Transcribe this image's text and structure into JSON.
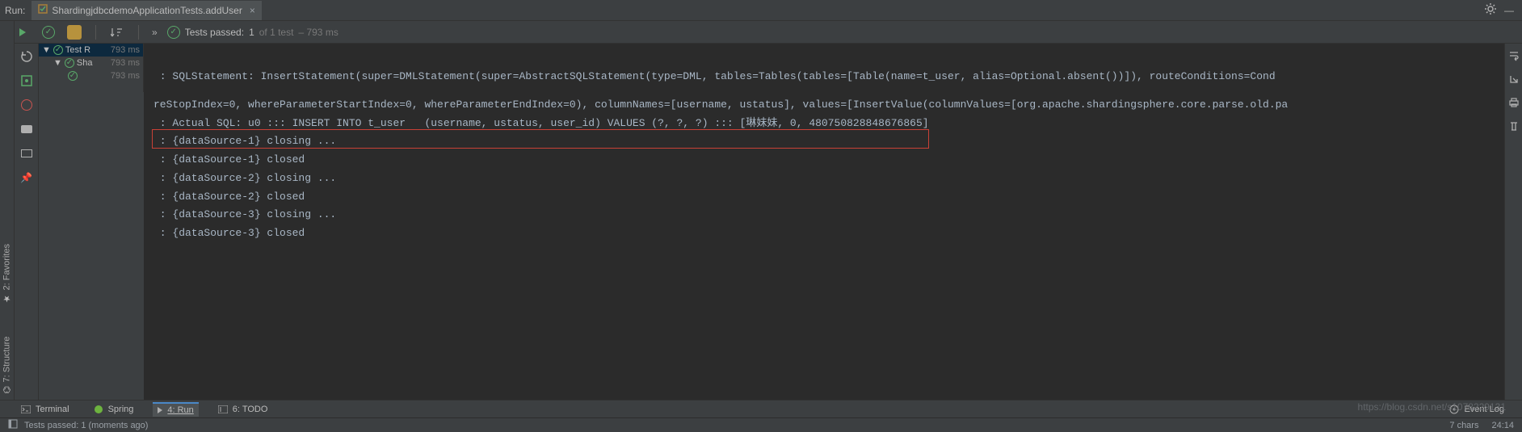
{
  "topbar": {
    "run_label": "Run:",
    "tab_title": "ShardingjdbcdemoApplicationTests.addUser"
  },
  "toolbar": {
    "tests_passed_prefix": "Tests passed:",
    "tests_passed_count": "1",
    "tests_passed_of": "of 1 test",
    "tests_passed_time": "– 793 ms"
  },
  "tree": {
    "root_label": "Test R",
    "root_time": "793 ms",
    "child_label": "Sha",
    "child_time": "793 ms",
    "leaf_time": "793 ms"
  },
  "console_lines": [
    " : SQLStatement: InsertStatement(super=DMLStatement(super=AbstractSQLStatement(type=DML, tables=Tables(tables=[Table(name=t_user, alias=Optional.absent())]), routeConditions=Cond",
    "reStopIndex=0, whereParameterStartIndex=0, whereParameterEndIndex=0), columnNames=[username, ustatus], values=[InsertValue(columnValues=[org.apache.shardingsphere.core.parse.old.pa",
    " : Actual SQL: u0 ::: INSERT INTO t_user   (username, ustatus, user_id) VALUES (?, ?, ?) ::: [琳妹妹, 0, 480750828848676865]",
    " : {dataSource-1} closing ...",
    " : {dataSource-1} closed",
    " : {dataSource-2} closing ...",
    " : {dataSource-2} closed",
    " : {dataSource-3} closing ...",
    " : {dataSource-3} closed"
  ],
  "sidebar": {
    "favorites": "2: Favorites",
    "structure": "7: Structure"
  },
  "bottom": {
    "terminal": "Terminal",
    "spring": "Spring",
    "run": "4: Run",
    "todo": "6: TODO",
    "event_log": "Event Log"
  },
  "status": {
    "message": "Tests passed: 1 (moments ago)",
    "chars": "7 chars",
    "position": "24:14"
  },
  "watermark": "https://blog.csdn.net/s1078229131"
}
